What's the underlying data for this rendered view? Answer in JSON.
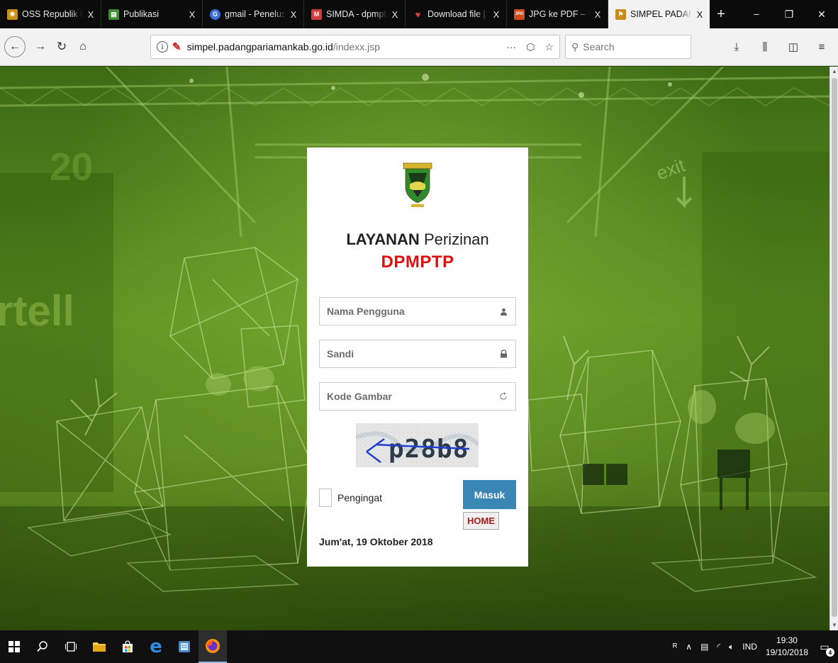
{
  "browser": {
    "tabs": [
      {
        "title": "OSS Republik Indon",
        "favicon_color": "#c89018",
        "active": false
      },
      {
        "title": "Publikasi",
        "favicon_color": "#3b8f2f",
        "active": false
      },
      {
        "title": "gmail - Penelusuran",
        "favicon_color": "#3b6fd8",
        "active": false
      },
      {
        "title": "SIMDA - dpmptp.pc",
        "favicon_color": "#d33b3b",
        "active": false
      },
      {
        "title": "Download file | iLov",
        "favicon_color": "#e33b3b",
        "active": false
      },
      {
        "title": "JPG ke PDF – Ubah",
        "favicon_color": "#d04a1a",
        "active": false
      },
      {
        "title": "SIMPEL PADANG P/",
        "favicon_color": "#c88a1a",
        "active": true
      }
    ],
    "tab_close_label": "X",
    "new_tab_label": "+",
    "window_controls": {
      "minimize": "−",
      "maximize": "❐",
      "close": "✕"
    },
    "url": {
      "domain": "simpel.padangpariamankab.go.id",
      "path": "/indexx.jsp"
    },
    "search_placeholder": "Search",
    "url_actions": {
      "more": "···",
      "pocket": "⬡",
      "bookmark": "☆"
    }
  },
  "login": {
    "title_bold": "LAYANAN",
    "title_rest": " Perizinan",
    "subtitle": "DPMPTP",
    "username_placeholder": "Nama Pengguna",
    "password_placeholder": "Sandi",
    "captcha_placeholder": "Kode Gambar",
    "captcha_text": "p28b8",
    "remember_label": "Pengingat",
    "submit_label": "Masuk",
    "home_label": "HOME",
    "date_text": "Jum'at, 19 Oktober 2018"
  },
  "taskbar": {
    "language": "IND",
    "time": "19:30",
    "date": "19/10/2018",
    "notification_count": "4"
  }
}
